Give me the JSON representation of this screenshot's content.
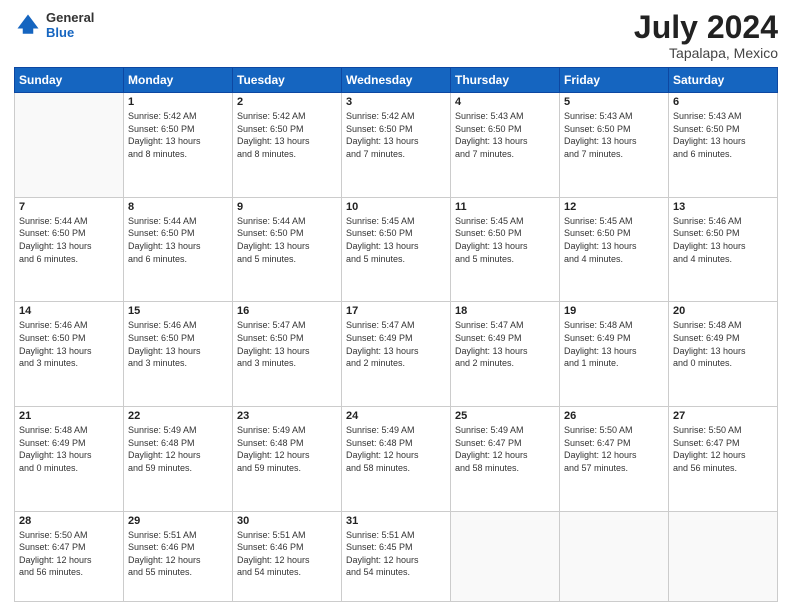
{
  "header": {
    "logo": {
      "general": "General",
      "blue": "Blue"
    },
    "title": "July 2024",
    "location": "Tapalapa, Mexico"
  },
  "days_of_week": [
    "Sunday",
    "Monday",
    "Tuesday",
    "Wednesday",
    "Thursday",
    "Friday",
    "Saturday"
  ],
  "weeks": [
    [
      {
        "day": null,
        "info": null
      },
      {
        "day": "1",
        "info": "Sunrise: 5:42 AM\nSunset: 6:50 PM\nDaylight: 13 hours\nand 8 minutes."
      },
      {
        "day": "2",
        "info": "Sunrise: 5:42 AM\nSunset: 6:50 PM\nDaylight: 13 hours\nand 8 minutes."
      },
      {
        "day": "3",
        "info": "Sunrise: 5:42 AM\nSunset: 6:50 PM\nDaylight: 13 hours\nand 7 minutes."
      },
      {
        "day": "4",
        "info": "Sunrise: 5:43 AM\nSunset: 6:50 PM\nDaylight: 13 hours\nand 7 minutes."
      },
      {
        "day": "5",
        "info": "Sunrise: 5:43 AM\nSunset: 6:50 PM\nDaylight: 13 hours\nand 7 minutes."
      },
      {
        "day": "6",
        "info": "Sunrise: 5:43 AM\nSunset: 6:50 PM\nDaylight: 13 hours\nand 6 minutes."
      }
    ],
    [
      {
        "day": "7",
        "info": "Sunrise: 5:44 AM\nSunset: 6:50 PM\nDaylight: 13 hours\nand 6 minutes."
      },
      {
        "day": "8",
        "info": "Sunrise: 5:44 AM\nSunset: 6:50 PM\nDaylight: 13 hours\nand 6 minutes."
      },
      {
        "day": "9",
        "info": "Sunrise: 5:44 AM\nSunset: 6:50 PM\nDaylight: 13 hours\nand 5 minutes."
      },
      {
        "day": "10",
        "info": "Sunrise: 5:45 AM\nSunset: 6:50 PM\nDaylight: 13 hours\nand 5 minutes."
      },
      {
        "day": "11",
        "info": "Sunrise: 5:45 AM\nSunset: 6:50 PM\nDaylight: 13 hours\nand 5 minutes."
      },
      {
        "day": "12",
        "info": "Sunrise: 5:45 AM\nSunset: 6:50 PM\nDaylight: 13 hours\nand 4 minutes."
      },
      {
        "day": "13",
        "info": "Sunrise: 5:46 AM\nSunset: 6:50 PM\nDaylight: 13 hours\nand 4 minutes."
      }
    ],
    [
      {
        "day": "14",
        "info": "Sunrise: 5:46 AM\nSunset: 6:50 PM\nDaylight: 13 hours\nand 3 minutes."
      },
      {
        "day": "15",
        "info": "Sunrise: 5:46 AM\nSunset: 6:50 PM\nDaylight: 13 hours\nand 3 minutes."
      },
      {
        "day": "16",
        "info": "Sunrise: 5:47 AM\nSunset: 6:50 PM\nDaylight: 13 hours\nand 3 minutes."
      },
      {
        "day": "17",
        "info": "Sunrise: 5:47 AM\nSunset: 6:49 PM\nDaylight: 13 hours\nand 2 minutes."
      },
      {
        "day": "18",
        "info": "Sunrise: 5:47 AM\nSunset: 6:49 PM\nDaylight: 13 hours\nand 2 minutes."
      },
      {
        "day": "19",
        "info": "Sunrise: 5:48 AM\nSunset: 6:49 PM\nDaylight: 13 hours\nand 1 minute."
      },
      {
        "day": "20",
        "info": "Sunrise: 5:48 AM\nSunset: 6:49 PM\nDaylight: 13 hours\nand 0 minutes."
      }
    ],
    [
      {
        "day": "21",
        "info": "Sunrise: 5:48 AM\nSunset: 6:49 PM\nDaylight: 13 hours\nand 0 minutes."
      },
      {
        "day": "22",
        "info": "Sunrise: 5:49 AM\nSunset: 6:48 PM\nDaylight: 12 hours\nand 59 minutes."
      },
      {
        "day": "23",
        "info": "Sunrise: 5:49 AM\nSunset: 6:48 PM\nDaylight: 12 hours\nand 59 minutes."
      },
      {
        "day": "24",
        "info": "Sunrise: 5:49 AM\nSunset: 6:48 PM\nDaylight: 12 hours\nand 58 minutes."
      },
      {
        "day": "25",
        "info": "Sunrise: 5:49 AM\nSunset: 6:47 PM\nDaylight: 12 hours\nand 58 minutes."
      },
      {
        "day": "26",
        "info": "Sunrise: 5:50 AM\nSunset: 6:47 PM\nDaylight: 12 hours\nand 57 minutes."
      },
      {
        "day": "27",
        "info": "Sunrise: 5:50 AM\nSunset: 6:47 PM\nDaylight: 12 hours\nand 56 minutes."
      }
    ],
    [
      {
        "day": "28",
        "info": "Sunrise: 5:50 AM\nSunset: 6:47 PM\nDaylight: 12 hours\nand 56 minutes."
      },
      {
        "day": "29",
        "info": "Sunrise: 5:51 AM\nSunset: 6:46 PM\nDaylight: 12 hours\nand 55 minutes."
      },
      {
        "day": "30",
        "info": "Sunrise: 5:51 AM\nSunset: 6:46 PM\nDaylight: 12 hours\nand 54 minutes."
      },
      {
        "day": "31",
        "info": "Sunrise: 5:51 AM\nSunset: 6:45 PM\nDaylight: 12 hours\nand 54 minutes."
      },
      {
        "day": null,
        "info": null
      },
      {
        "day": null,
        "info": null
      },
      {
        "day": null,
        "info": null
      }
    ]
  ]
}
